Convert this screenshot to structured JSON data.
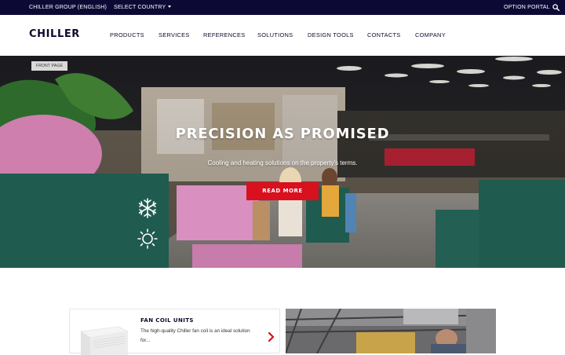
{
  "topbar": {
    "group": "CHILLER GROUP (ENGLISH)",
    "country": "SELECT COUNTRY",
    "portal": "OPTION PORTAL"
  },
  "header": {
    "logo": "CHILLER",
    "nav": [
      "PRODUCTS",
      "SERVICES",
      "REFERENCES",
      "SOLUTIONS",
      "DESIGN TOOLS",
      "CONTACTS",
      "COMPANY"
    ]
  },
  "hero": {
    "breadcrumb": "FRONT PAGE",
    "title": "PRECISION AS PROMISED",
    "subtitle": "Cooling and heating solutions on the property's terms.",
    "cta": "READ MORE"
  },
  "cards": [
    {
      "title": "FAN COIL UNITS",
      "description": "The high-quality Chiller fan coil is an ideal solution for..."
    }
  ],
  "colors": {
    "topbar": "#0c0a35",
    "accent": "#d9101e",
    "navy": "#0c0a2e",
    "hero_green": "#1f5b4f",
    "hero_pink": "#d98fbf"
  },
  "icons": [
    "search-icon",
    "caret-down-icon",
    "snowflake-icon",
    "sun-icon",
    "chevron-right-icon"
  ]
}
